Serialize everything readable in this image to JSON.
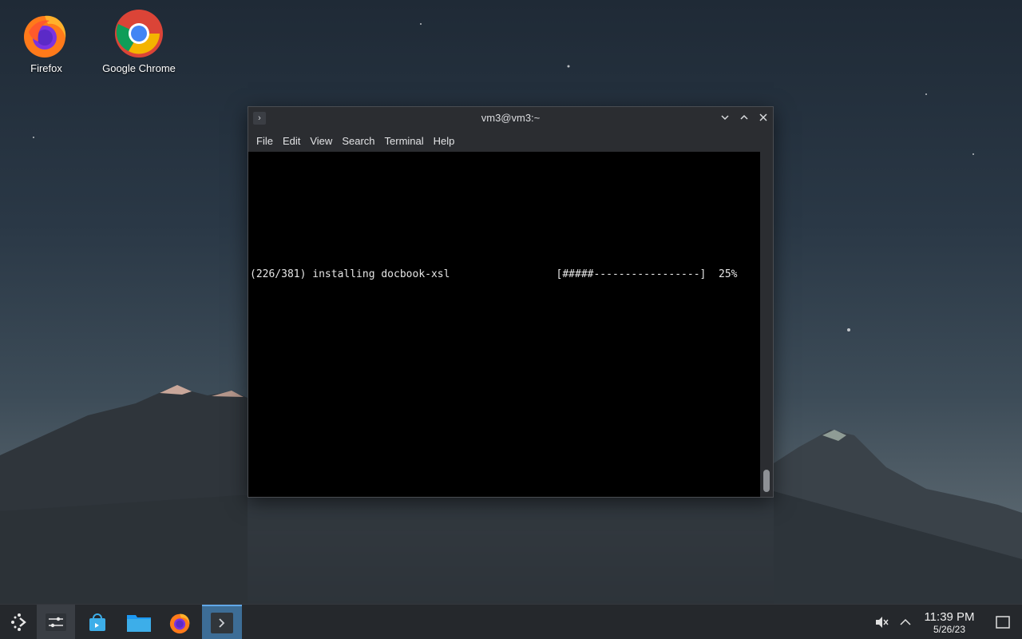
{
  "desktop": {
    "icons": [
      {
        "label": "Firefox",
        "icon": "firefox-icon"
      },
      {
        "label": "Google Chrome",
        "icon": "chrome-icon"
      }
    ]
  },
  "terminal": {
    "title": "vm3@vm3:~",
    "menu": [
      "File",
      "Edit",
      "View",
      "Search",
      "Terminal",
      "Help"
    ],
    "output_line": "(226/381) installing docbook-xsl                 [#####-----------------]  25%",
    "progress_percent": 25
  },
  "taskbar": {
    "launchers": [
      "application-launcher-icon",
      "system-settings-icon",
      "discover-store-icon",
      "file-manager-icon",
      "firefox-icon",
      "terminal-icon"
    ],
    "tray": {
      "volume_icon": "muted-speaker-icon",
      "expand_icon": "chevron-up-icon",
      "time": "11:39 PM",
      "date": "5/26/23",
      "show_desktop_icon": "show-desktop-icon"
    }
  },
  "colors": {
    "taskbar_bg": "#25282c",
    "active_task": "#3d6d96",
    "terminal_bg": "#000000"
  }
}
